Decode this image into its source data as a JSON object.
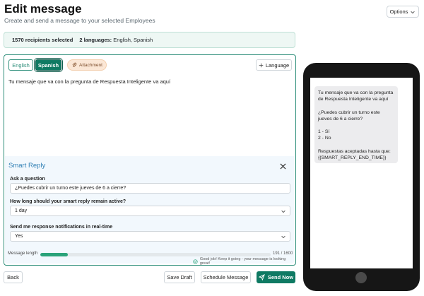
{
  "header": {
    "title": "Edit message",
    "subtitle": "Create and send a message to your selected Employees",
    "options_label": "Options"
  },
  "recipients": {
    "count_text": "1570 recipients selected",
    "languages_label": "2 languages:",
    "languages_value": "English, Spanish"
  },
  "editor": {
    "tabs": [
      {
        "label": "English",
        "active": false
      },
      {
        "label": "Spanish",
        "active": true
      }
    ],
    "attachment_label": "Attachment",
    "add_language_label": "Language",
    "message": "Tu mensaje que va con la pregunta de Respuesta Inteligente va aquí"
  },
  "smart_reply": {
    "title": "Smart Reply",
    "question_label": "Ask a question",
    "question_value": "¿Puedes cubrir un turno este jueves de 6 a cierre?",
    "duration_label": "How long should your smart reply remain active?",
    "duration_value": "1 day",
    "notify_label": "Send me response notifications in real-time",
    "notify_value": "Yes"
  },
  "meter": {
    "label": "Message length",
    "count": "191 / 1600",
    "fill_fraction": 0.12,
    "feedback": "Good job! Keep it going - your message is looking great!"
  },
  "footer": {
    "back_label": "Back",
    "save_draft_label": "Save Draft",
    "schedule_label": "Schedule Message",
    "send_label": "Send Now"
  },
  "preview": {
    "line1": "Tu mensaje que va con la pregunta de Respuesta Inteligente va aquí",
    "line2": "¿Puedes cubrir un turno este jueves de 6 a cierre?",
    "line3": "1 - Sí",
    "line4": "2 - No",
    "line5": "Respuestas aceptadas hasta que: {{SMART_REPLY_END_TIME}}"
  },
  "colors": {
    "accent": "#0f7a63",
    "smart_reply_bg": "#f2f8fd",
    "attachment_bg": "#fbe7d6"
  }
}
